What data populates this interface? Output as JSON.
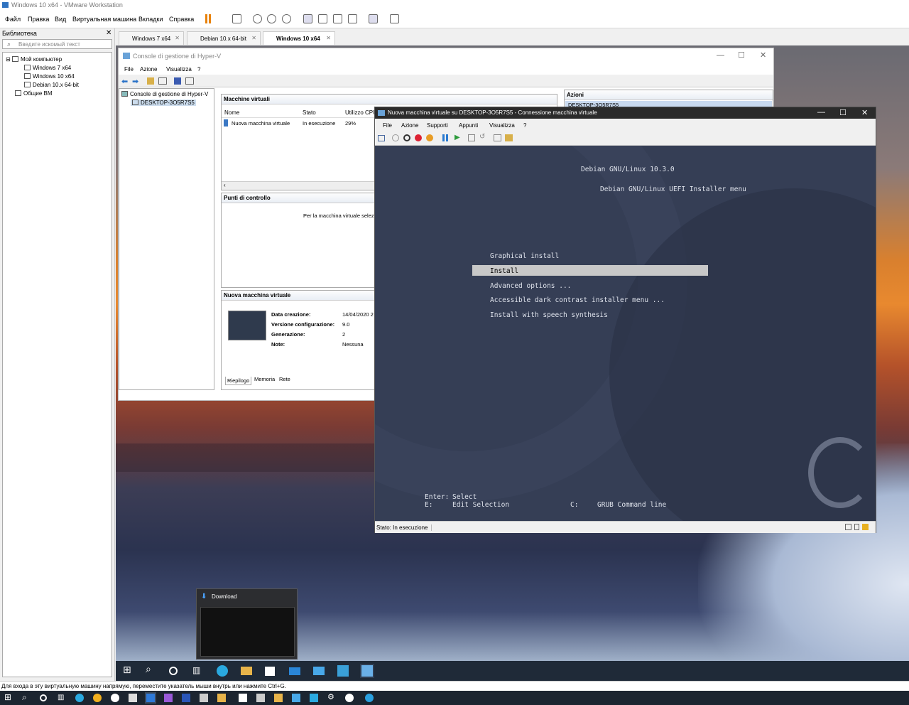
{
  "window": {
    "title": "Windows 10 x64 - VMware Workstation"
  },
  "menu": [
    "Файл",
    "Правка",
    "Вид",
    "Виртуальная машина",
    "Вкладки",
    "Справка"
  ],
  "library": {
    "title": "Библиотека",
    "search_placeholder": "Введите искомый текст",
    "root": "Мой компьютер",
    "vms": [
      "Windows 7 x64",
      "Windows 10 x64",
      "Debian 10.x 64-bit"
    ],
    "shared": "Общие ВМ"
  },
  "tabs": [
    "Windows 7 x64",
    "Debian 10.x 64-bit",
    "Windows 10 x64"
  ],
  "hyperv": {
    "title": "Console di gestione di Hyper-V",
    "menu": [
      "File",
      "Azione",
      "Visualizza",
      "?"
    ],
    "tree_root": "Console di gestione di Hyper-V",
    "tree_host": "DESKTOP-3O5R7S5",
    "vm_panel": "Macchine virtuali",
    "columns": [
      "Nome",
      "Stato",
      "Utilizzo CPU"
    ],
    "vm_row": {
      "name": "Nuova macchina virtuale",
      "state": "In esecuzione",
      "cpu": "29%"
    },
    "checkpoints": "Punti di controllo",
    "checkpoint_msg": "Per la macchina virtuale selezi",
    "details_title": "Nuova macchina virtuale",
    "details": [
      {
        "k": "Data creazione:",
        "v": "14/04/2020 2"
      },
      {
        "k": "Versione configurazione:",
        "v": "9.0"
      },
      {
        "k": "Generazione:",
        "v": "2"
      },
      {
        "k": "Note:",
        "v": "Nessuna"
      }
    ],
    "detail_tabs": [
      "Riepilogo",
      "Memoria",
      "Rete"
    ],
    "actions": "Azioni",
    "actions_host": "DESKTOP-3O5R7S5"
  },
  "vmconnect": {
    "title": "Nuova macchina virtuale su DESKTOP-3O5R7S5 - Connessione macchina virtuale",
    "menu": [
      "File",
      "Azione",
      "Supporti",
      "Appunti",
      "Visualizza",
      "?"
    ],
    "status": "Stato: In esecuzione"
  },
  "grub": {
    "title": "Debian GNU/Linux 10.3.0",
    "subtitle": "Debian GNU/Linux UEFI Installer menu",
    "items": [
      "Graphical install",
      "Install",
      "Advanced options ...",
      "Accessible dark contrast installer menu ...",
      "Install with speech synthesis"
    ],
    "selected": 1,
    "help_enter_key": "Enter:",
    "help_enter": "Select",
    "help_e_key": "E:",
    "help_e": "Edit Selection",
    "help_c_key": "C:",
    "help_c": "GRUB Command line"
  },
  "download": {
    "title": "Download"
  },
  "hint": "Для входа в эту виртуальную машину напрямую, переместите указатель мыши внутрь или нажмите Ctrl+G.",
  "colors": {
    "grub_bg": "#353e55",
    "selection": "#c8c8c8",
    "taskbar": "#1f2a38"
  }
}
